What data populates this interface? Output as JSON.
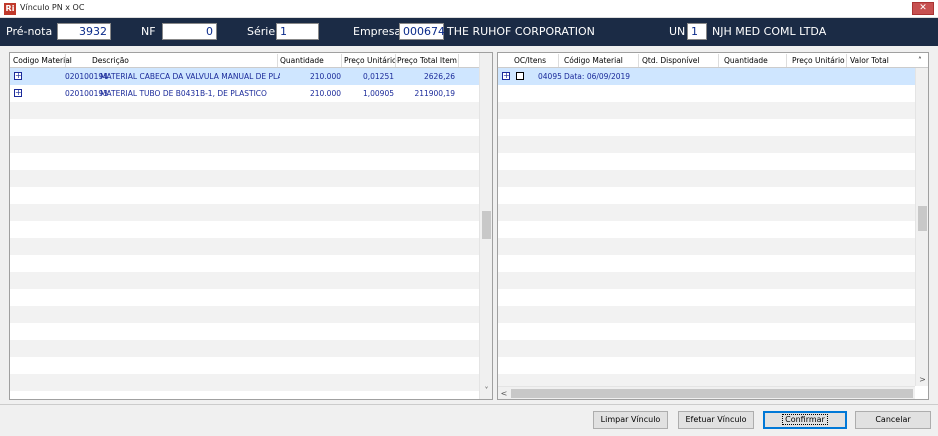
{
  "window": {
    "title": "Vínculo PN x OC",
    "app_icon": "Ri",
    "close_glyph": "✕"
  },
  "header": {
    "prenota_label": "Pré-nota",
    "prenota_value": "3932",
    "nf_label": "NF",
    "nf_value": "0",
    "serie_label": "Série",
    "serie_value": "1",
    "empresa_label": "Empresa",
    "empresa_code": "000674",
    "empresa_name": "THE RUHOF CORPORATION",
    "un_label": "UN",
    "un_value": "1",
    "un_name": "NJH MED COML LTDA"
  },
  "left_grid": {
    "columns": [
      "Codigo Material",
      "Descrição",
      "Quantidade",
      "Preço Unitário",
      "Preço Total Item"
    ],
    "rows": [
      {
        "expand": "+",
        "code": "020100194",
        "description": "MATERIAL CABECA DA VALVULA MANUAL DE PLASTI",
        "quantity": "210.000",
        "unit_price": "0,01251",
        "total": "2626,26"
      },
      {
        "expand": "+",
        "code": "020100193",
        "description": "MATERIAL TUBO DE B0431B-1, DE PLASTICO",
        "quantity": "210.000",
        "unit_price": "1,00905",
        "total": "211900,19"
      }
    ]
  },
  "right_grid": {
    "columns": [
      "OC/Itens",
      "Código Material",
      "Qtd. Disponível",
      "Quantidade",
      "Preço Unitário",
      "Valor Total"
    ],
    "rows": [
      {
        "expand": "+",
        "oc": "04095",
        "info": "Data: 06/09/2019"
      }
    ]
  },
  "scroll": {
    "up": "˄",
    "down": "˅",
    "left": "<",
    "right": ">"
  },
  "buttons": {
    "limpar": "Limpar Vínculo",
    "efetuar": "Efetuar Vínculo",
    "confirmar": "Confirmar",
    "cancelar": "Cancelar"
  },
  "colors": {
    "header_bg": "#1b2b45",
    "selected_row": "#cfe6ff",
    "grid_text": "#1a2a9a"
  }
}
